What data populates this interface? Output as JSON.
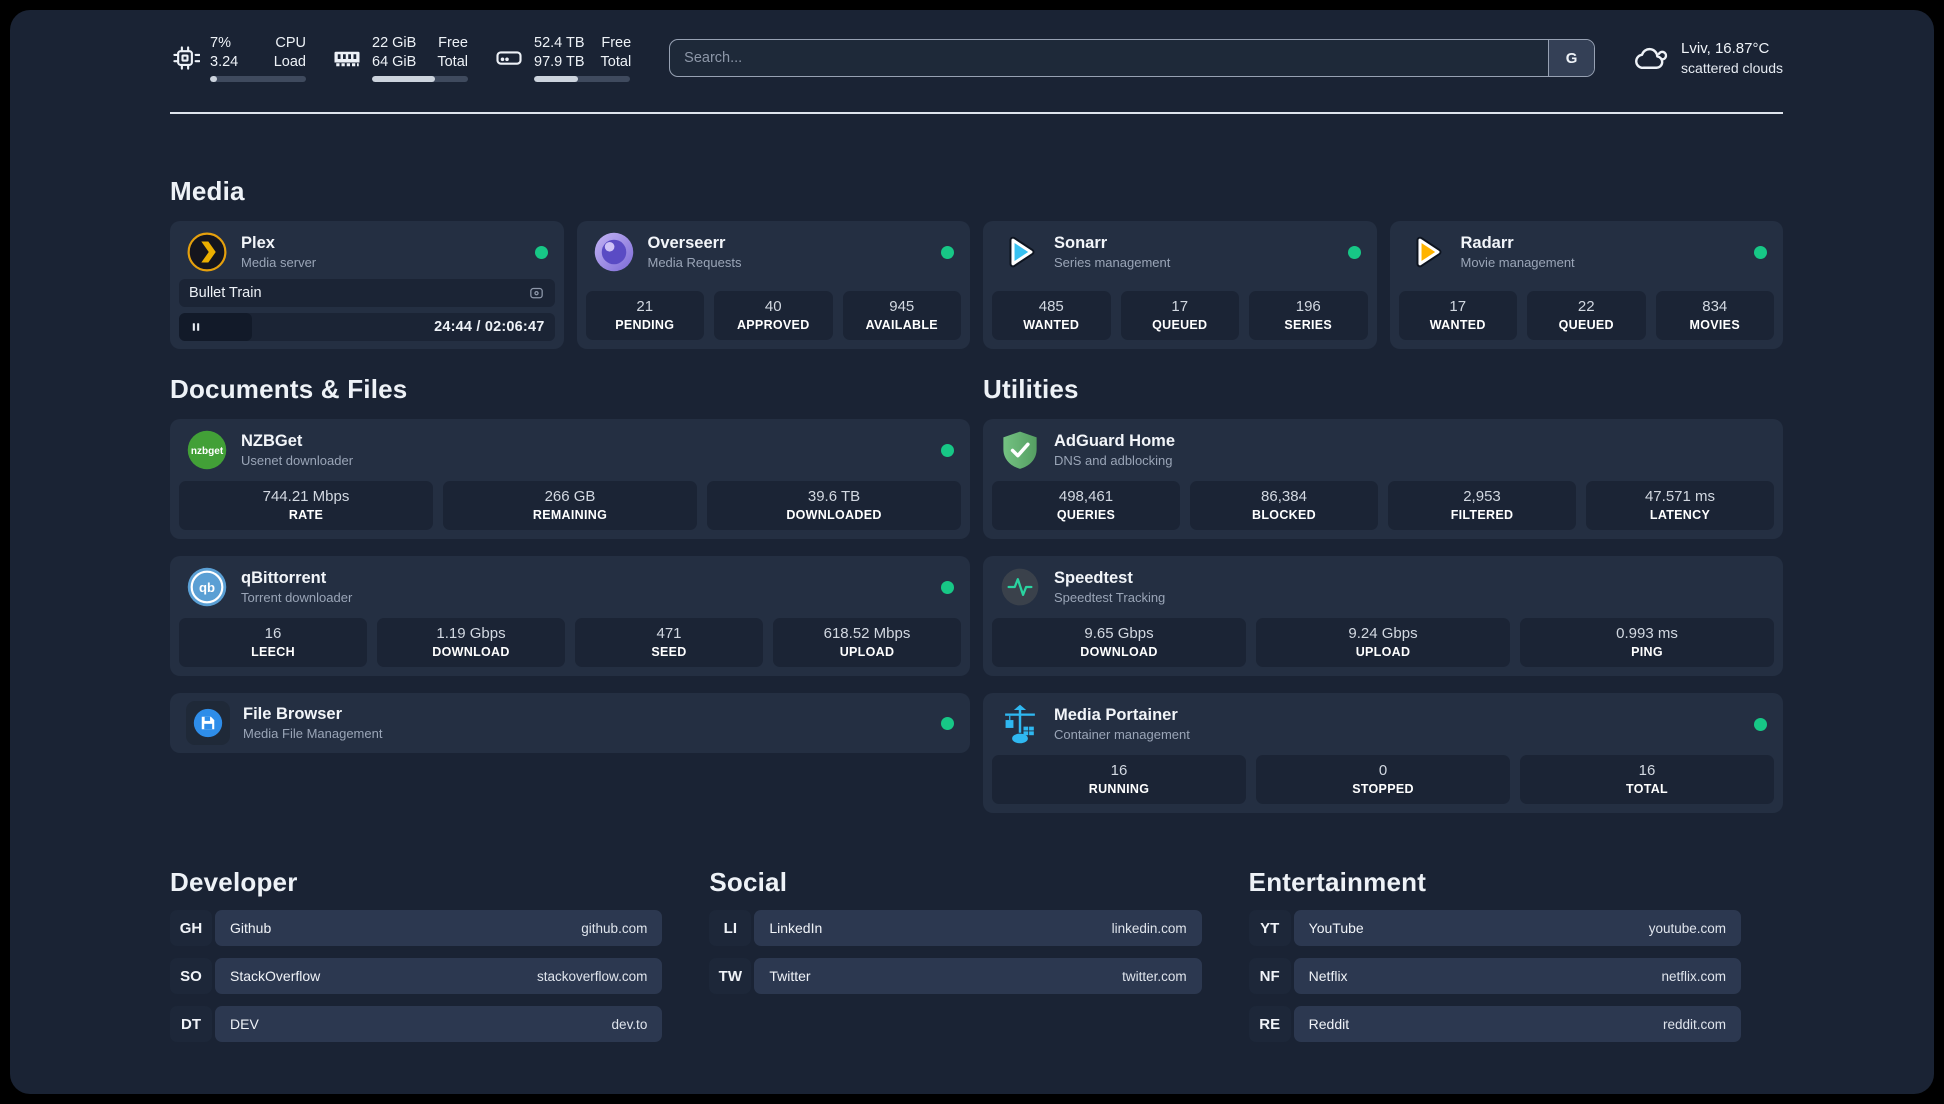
{
  "header": {
    "stats": [
      {
        "icon": "cpu-icon",
        "values": [
          "7%",
          "3.24"
        ],
        "labels": [
          "CPU",
          "Load"
        ],
        "progress_style": "width:7%"
      },
      {
        "icon": "ram-icon",
        "values": [
          "22 GiB",
          "64 GiB"
        ],
        "labels": [
          "Free",
          "Total"
        ],
        "progress_style": "width:66%"
      },
      {
        "icon": "disk-icon",
        "values": [
          "52.4 TB",
          "97.9 TB"
        ],
        "labels": [
          "Free",
          "Total"
        ],
        "progress_style": "width:46%"
      }
    ],
    "search": {
      "placeholder": "Search...",
      "engine": "G"
    },
    "weather": {
      "line1": "Lviv, 16.87°C",
      "line2": "scattered clouds"
    }
  },
  "media": {
    "title": "Media",
    "plex": {
      "name": "Plex",
      "subtitle": "Media server",
      "now_playing": "Bullet Train",
      "time": "24:44 / 02:06:47",
      "progress_style": "width:19.5%"
    },
    "overseerr": {
      "name": "Overseerr",
      "subtitle": "Media Requests",
      "stats": [
        {
          "value": "21",
          "label": "PENDING"
        },
        {
          "value": "40",
          "label": "APPROVED"
        },
        {
          "value": "945",
          "label": "AVAILABLE"
        }
      ]
    },
    "sonarr": {
      "name": "Sonarr",
      "subtitle": "Series management",
      "stats": [
        {
          "value": "485",
          "label": "WANTED"
        },
        {
          "value": "17",
          "label": "QUEUED"
        },
        {
          "value": "196",
          "label": "SERIES"
        }
      ]
    },
    "radarr": {
      "name": "Radarr",
      "subtitle": "Movie management",
      "stats": [
        {
          "value": "17",
          "label": "WANTED"
        },
        {
          "value": "22",
          "label": "QUEUED"
        },
        {
          "value": "834",
          "label": "MOVIES"
        }
      ]
    }
  },
  "documents": {
    "title": "Documents & Files",
    "nzbget": {
      "name": "NZBGet",
      "subtitle": "Usenet downloader",
      "stats": [
        {
          "value": "744.21 Mbps",
          "label": "RATE"
        },
        {
          "value": "266 GB",
          "label": "REMAINING"
        },
        {
          "value": "39.6 TB",
          "label": "DOWNLOADED"
        }
      ]
    },
    "qbittorrent": {
      "name": "qBittorrent",
      "subtitle": "Torrent downloader",
      "stats": [
        {
          "value": "16",
          "label": "LEECH"
        },
        {
          "value": "1.19 Gbps",
          "label": "DOWNLOAD"
        },
        {
          "value": "471",
          "label": "SEED"
        },
        {
          "value": "618.52 Mbps",
          "label": "UPLOAD"
        }
      ]
    },
    "filebrowser": {
      "name": "File Browser",
      "subtitle": "Media File Management"
    }
  },
  "utilities": {
    "title": "Utilities",
    "adguard": {
      "name": "AdGuard Home",
      "subtitle": "DNS and adblocking",
      "stats": [
        {
          "value": "498,461",
          "label": "QUERIES"
        },
        {
          "value": "86,384",
          "label": "BLOCKED"
        },
        {
          "value": "2,953",
          "label": "FILTERED"
        },
        {
          "value": "47.571 ms",
          "label": "LATENCY"
        }
      ]
    },
    "speedtest": {
      "name": "Speedtest",
      "subtitle": "Speedtest Tracking",
      "stats": [
        {
          "value": "9.65 Gbps",
          "label": "DOWNLOAD"
        },
        {
          "value": "9.24 Gbps",
          "label": "UPLOAD"
        },
        {
          "value": "0.993 ms",
          "label": "PING"
        }
      ]
    },
    "portainer": {
      "name": "Media Portainer",
      "subtitle": "Container management",
      "stats": [
        {
          "value": "16",
          "label": "RUNNING"
        },
        {
          "value": "0",
          "label": "STOPPED"
        },
        {
          "value": "16",
          "label": "TOTAL"
        }
      ]
    }
  },
  "bookmarks": {
    "developer": {
      "title": "Developer",
      "items": [
        {
          "abbr": "GH",
          "name": "Github",
          "url": "github.com"
        },
        {
          "abbr": "SO",
          "name": "StackOverflow",
          "url": "stackoverflow.com"
        },
        {
          "abbr": "DT",
          "name": "DEV",
          "url": "dev.to"
        }
      ]
    },
    "social": {
      "title": "Social",
      "items": [
        {
          "abbr": "LI",
          "name": "LinkedIn",
          "url": "linkedin.com"
        },
        {
          "abbr": "TW",
          "name": "Twitter",
          "url": "twitter.com"
        }
      ]
    },
    "entertainment": {
      "title": "Entertainment",
      "items": [
        {
          "abbr": "YT",
          "name": "YouTube",
          "url": "youtube.com"
        },
        {
          "abbr": "NF",
          "name": "Netflix",
          "url": "netflix.com"
        },
        {
          "abbr": "RE",
          "name": "Reddit",
          "url": "reddit.com"
        }
      ]
    }
  },
  "colors": {
    "background": "#1a2334",
    "card": "#242f42",
    "stat_box": "#1b2435",
    "status_online": "#17c786",
    "plex_accent": "#ebaf00",
    "overseerr_accent": "#8070d4",
    "sonarr_accent": "#38c1f1",
    "radarr_accent": "#ffb300",
    "nzbget_accent": "#42a037",
    "qbittorrent_accent": "#5a9fd4",
    "adguard_accent": "#67b279",
    "speedtest_accent": "#2ad3a0",
    "filebrowser_accent": "#2e8de9",
    "portainer_accent": "#2fb8f1"
  }
}
